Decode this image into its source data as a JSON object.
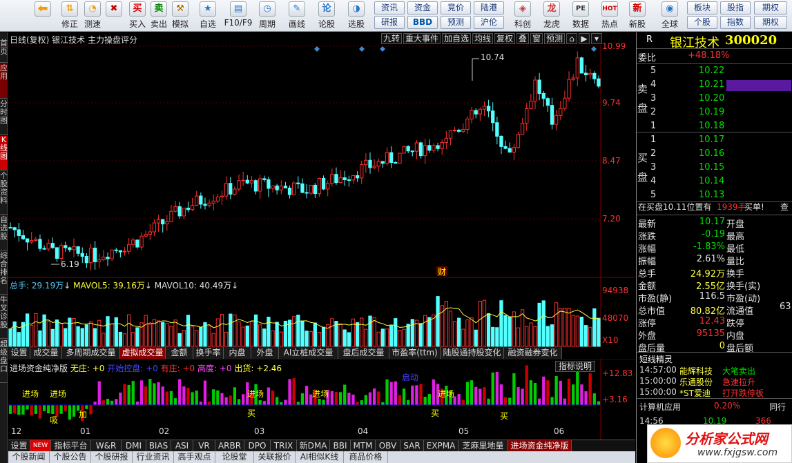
{
  "toolbar": {
    "buttons": [
      {
        "label": "修正",
        "icon": "up-down-icon"
      },
      {
        "label": "测速",
        "icon": "speedometer-icon"
      },
      {
        "label": "买入",
        "icon": "buy-icon",
        "glyph": "买"
      },
      {
        "label": "卖出",
        "icon": "sell-icon",
        "glyph": "卖"
      },
      {
        "label": "模拟",
        "icon": "gavel-icon"
      },
      {
        "label": "自选",
        "icon": "star-icon"
      },
      {
        "label": "F10/F9",
        "icon": "f10-icon"
      },
      {
        "label": "周期",
        "icon": "clock-icon"
      },
      {
        "label": "画线",
        "icon": "pencil-icon"
      },
      {
        "label": "论股",
        "icon": "discuss-icon"
      },
      {
        "label": "选股",
        "icon": "gauge-icon"
      },
      {
        "label": "科创",
        "icon": "kechuang-icon"
      },
      {
        "label": "龙虎",
        "icon": "dragon-icon"
      },
      {
        "label": "数据",
        "icon": "pe-icon",
        "glyph": "PE"
      },
      {
        "label": "热点",
        "icon": "hot-icon",
        "glyph": "HOT"
      },
      {
        "label": "新股",
        "icon": "new-stock-icon"
      },
      {
        "label": "全球",
        "icon": "globe-icon"
      },
      {
        "label": "个股",
        "icon": "stock-icon"
      },
      {
        "label": "指数",
        "icon": "index-icon"
      },
      {
        "label": "期权",
        "icon": "option-icon"
      }
    ],
    "small_buttons": [
      "资讯",
      "资金",
      "竞价",
      "陆港",
      "研报",
      "BBD",
      "预测",
      "沪伦",
      "板块",
      "股指",
      "期权",
      "个股",
      "指数",
      "期权"
    ]
  },
  "left_tabs": [
    "首页",
    "应用",
    "分时图",
    "K线图",
    "个股资料",
    "自选股",
    "综合排名",
    "牛叉诊股",
    "超级盘口"
  ],
  "chart": {
    "header": "日线(复权)  银江技术  主力操盘评分",
    "tools": [
      "九转",
      "重大事件",
      "加自选",
      "均线",
      "复权",
      "叠",
      "窗",
      "预测"
    ],
    "price_axis": [
      "10.99",
      "9.74",
      "8.47",
      "7.20"
    ],
    "high_label": "10.74",
    "low_label": "6.19",
    "event_marker": "财",
    "volume_header": {
      "total": "总手: 29.19万",
      "ma5": "MAVOL5: 39.16万",
      "ma10": "MAVOL10: 40.49万"
    },
    "volume_axis": [
      "94938",
      "48070",
      "X10"
    ],
    "sub_tabs": [
      "设置",
      "成交量",
      "多周期成交量",
      "虚拟成交量",
      "金额",
      "换手率",
      "内盘",
      "外盘",
      "AI立桩成交量",
      "盘后成交量",
      "市盈率(ttm)",
      "陆股通持股变化",
      "融资融券变化"
    ],
    "indicator_header": {
      "name": "进场资金纯净版",
      "wuzhuang": "无庄: +0",
      "kaishi": "开始控盘: +0",
      "youzhuang": "有庄: +0",
      "gaodu": "高度: +0",
      "chuhuo": "出货: +2.46"
    },
    "indicator_help": "指标说明",
    "indicator_axis": [
      "+12.83",
      "+3.16"
    ],
    "indicator_labels": [
      "进场",
      "进场",
      "吸",
      "加",
      "进场",
      "买",
      "进场",
      "启动",
      "买",
      "进场",
      "买"
    ],
    "date_axis": [
      "12",
      "01",
      "02",
      "03",
      "04",
      "05",
      "06"
    ],
    "bottom_tabs": [
      "设置",
      "NEW",
      "指标平台",
      "W&R",
      "DMI",
      "BIAS",
      "ASI",
      "VR",
      "ARBR",
      "DPO",
      "TRIX",
      "新DMA",
      "BBI",
      "MTM",
      "OBV",
      "SAR",
      "EXPMA",
      "芝麻里地量",
      "进场资金纯净版"
    ],
    "news_tabs": [
      "个股新闻",
      "个股公告",
      "个股研报",
      "行业资讯",
      "高手观点",
      "论股堂",
      "关联报价",
      "AI相似K线",
      "商品价格"
    ],
    "colors": {
      "up": "#ff3030",
      "down": "#54ffff",
      "ma": "#ffff40"
    }
  },
  "quote": {
    "name": "银江技术",
    "code": "300020",
    "r_badge": "R",
    "weibi_label": "委比",
    "weibi": "+48.18%",
    "sell_label": "卖盘",
    "buy_label": "买盘",
    "asks": [
      {
        "lv": "5",
        "p": "10.22"
      },
      {
        "lv": "4",
        "p": "10.21"
      },
      {
        "lv": "3",
        "p": "10.20"
      },
      {
        "lv": "2",
        "p": "10.19"
      },
      {
        "lv": "1",
        "p": "10.18"
      }
    ],
    "bids": [
      {
        "lv": "1",
        "p": "10.17"
      },
      {
        "lv": "2",
        "p": "10.16"
      },
      {
        "lv": "3",
        "p": "10.15"
      },
      {
        "lv": "4",
        "p": "10.14"
      },
      {
        "lv": "5",
        "p": "10.13"
      }
    ],
    "trade_note": "在买盘10.11位置有",
    "trade_vol": "1939手",
    "trade_tag": "买单!",
    "trade_more": "查",
    "stats": [
      {
        "l": "最新",
        "v": "10.17",
        "c": "green",
        "r": "开盘"
      },
      {
        "l": "涨跌",
        "v": "-0.19",
        "c": "green",
        "r": "最高"
      },
      {
        "l": "涨幅",
        "v": "-1.83%",
        "c": "green",
        "r": "最低"
      },
      {
        "l": "振幅",
        "v": "2.61%",
        "c": "white",
        "r": "量比"
      },
      {
        "l": "总手",
        "v": "24.92万",
        "c": "yel",
        "r": "换手"
      },
      {
        "l": "金额",
        "v": "2.55亿",
        "c": "yel",
        "r": "换手(实)"
      },
      {
        "l": "市盈(静)",
        "v": "116.5",
        "c": "white",
        "r": "市盈(动)"
      },
      {
        "l": "总市值",
        "v": "80.82亿",
        "c": "yel",
        "r": "流通值"
      },
      {
        "l": "涨停",
        "v": "12.43",
        "c": "red",
        "r": "跌停"
      },
      {
        "l": "外盘",
        "v": "95135",
        "c": "red",
        "r": "内盘"
      },
      {
        "l": "盘后量",
        "v": "0",
        "c": "yel",
        "r": "盘后额"
      }
    ],
    "flow_extra": "63",
    "news_title": "短线精灵",
    "news": [
      {
        "t": "14:57:00",
        "n": "能辉科技",
        "e": "大笔卖出",
        "ec": "green"
      },
      {
        "t": "15:00:00",
        "n": "乐通股份",
        "e": "急速拉升",
        "ec": "red"
      },
      {
        "t": "15:00:00",
        "n": "*ST爱迪",
        "e": "打开跌停板",
        "ec": "red"
      }
    ],
    "calc_label": "计算机应用",
    "calc_val": "0.20%",
    "calc_tail": "同行",
    "tick_time": "14:56",
    "tick_price": "10.19",
    "tick_vol": "366"
  },
  "watermark": {
    "text": "分析家公式网",
    "url": "www.fxjgsw.com"
  }
}
